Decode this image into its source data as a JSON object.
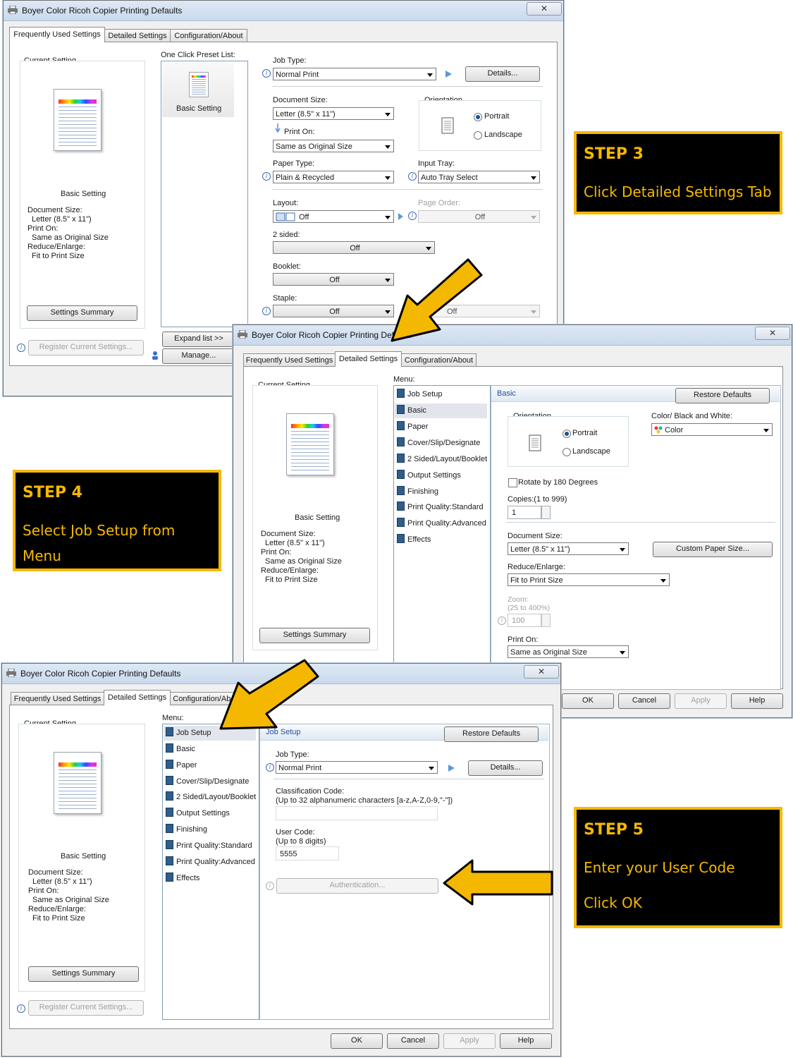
{
  "colors": {
    "step_bg": "#000000",
    "step_accent": "#f5b800",
    "link_blue": "#1d4f9e"
  },
  "common": {
    "window_title": "Boyer Color Ricoh Copier Printing Defaults",
    "tabs": [
      "Frequently Used Settings",
      "Detailed Settings",
      "Configuration/About"
    ],
    "current_setting": "Current Setting",
    "basic_setting": "Basic Setting",
    "summary": {
      "doc_size_label": "Document Size:",
      "doc_size_value": "Letter (8.5\" x 11\")",
      "print_on_label": "Print On:",
      "print_on_value": "Same as Original Size",
      "reduce_label": "Reduce/Enlarge:",
      "reduce_value": "Fit to Print Size"
    },
    "settings_summary": "Settings Summary",
    "register": "Register Current Settings...",
    "ok": "OK",
    "cancel": "Cancel",
    "apply": "Apply",
    "help": "Help",
    "restore_defaults": "Restore Defaults",
    "menu_label": "Menu:",
    "menu_items": [
      "Job Setup",
      "Basic",
      "Paper",
      "Cover/Slip/Designate",
      "2 Sided/Layout/Booklet",
      "Output Settings",
      "Finishing",
      "Print Quality:Standard",
      "Print Quality:Advanced",
      "Effects"
    ],
    "close_glyph": "✕"
  },
  "win1": {
    "preset_list_label": "One Click Preset List:",
    "preset_item": "Basic Setting",
    "expand_list": "Expand list >>",
    "manage": "Manage...",
    "job_type_label": "Job Type:",
    "job_type_value": "Normal Print",
    "details": "Details...",
    "doc_size_label": "Document Size:",
    "doc_size_value": "Letter (8.5\" x 11\")",
    "print_on_label": "Print On:",
    "print_on_value": "Same as Original Size",
    "orientation_label": "Orientation",
    "portrait": "Portrait",
    "landscape": "Landscape",
    "paper_type_label": "Paper Type:",
    "paper_type_value": "Plain & Recycled",
    "input_tray_label": "Input Tray:",
    "input_tray_value": "Auto Tray Select",
    "layout_label": "Layout:",
    "layout_value": "Off",
    "page_order_label": "Page Order:",
    "page_order_value": "Off",
    "two_sided_label": "2 sided:",
    "two_sided_value": "Off",
    "booklet_label": "Booklet:",
    "booklet_value": "Off",
    "staple_label": "Staple:",
    "staple_value": "Off",
    "punch_value": "Off"
  },
  "win2": {
    "section_title": "Basic",
    "orientation_label": "Orientation",
    "portrait": "Portrait",
    "landscape": "Landscape",
    "color_label": "Color/ Black and White:",
    "color_value": "Color",
    "rotate_label": "Rotate by 180 Degrees",
    "copies_label": "Copies:(1 to 999)",
    "copies_value": "1",
    "doc_size_label": "Document Size:",
    "doc_size_value": "Letter (8.5\" x 11\")",
    "custom_paper": "Custom Paper Size...",
    "reduce_label": "Reduce/Enlarge:",
    "reduce_value": "Fit to Print Size",
    "zoom_label": "Zoom:",
    "zoom_range": "(25 to 400%)",
    "zoom_value": "100",
    "print_on_label": "Print On:",
    "print_on_value": "Same as Original Size"
  },
  "win3": {
    "section_title": "Job Setup",
    "job_type_label": "Job Type:",
    "job_type_value": "Normal Print",
    "details": "Details...",
    "class_code_label": "Classification Code:",
    "class_code_hint": "(Up to 32 alphanumeric characters [a-z,A-Z,0-9,\"-\"])",
    "user_code_label": "User Code:",
    "user_code_hint": "(Up to 8 digits)",
    "user_code_value": "5555",
    "authentication": "Authentication..."
  },
  "steps": {
    "step3": {
      "title": "STEP 3",
      "line1": "Click Detailed Settings Tab"
    },
    "step4": {
      "title": "STEP 4",
      "line1": "Select Job Setup from",
      "line2": "Menu"
    },
    "step5": {
      "title": "STEP 5",
      "line1": "Enter your User Code",
      "line2": "Click OK"
    }
  }
}
